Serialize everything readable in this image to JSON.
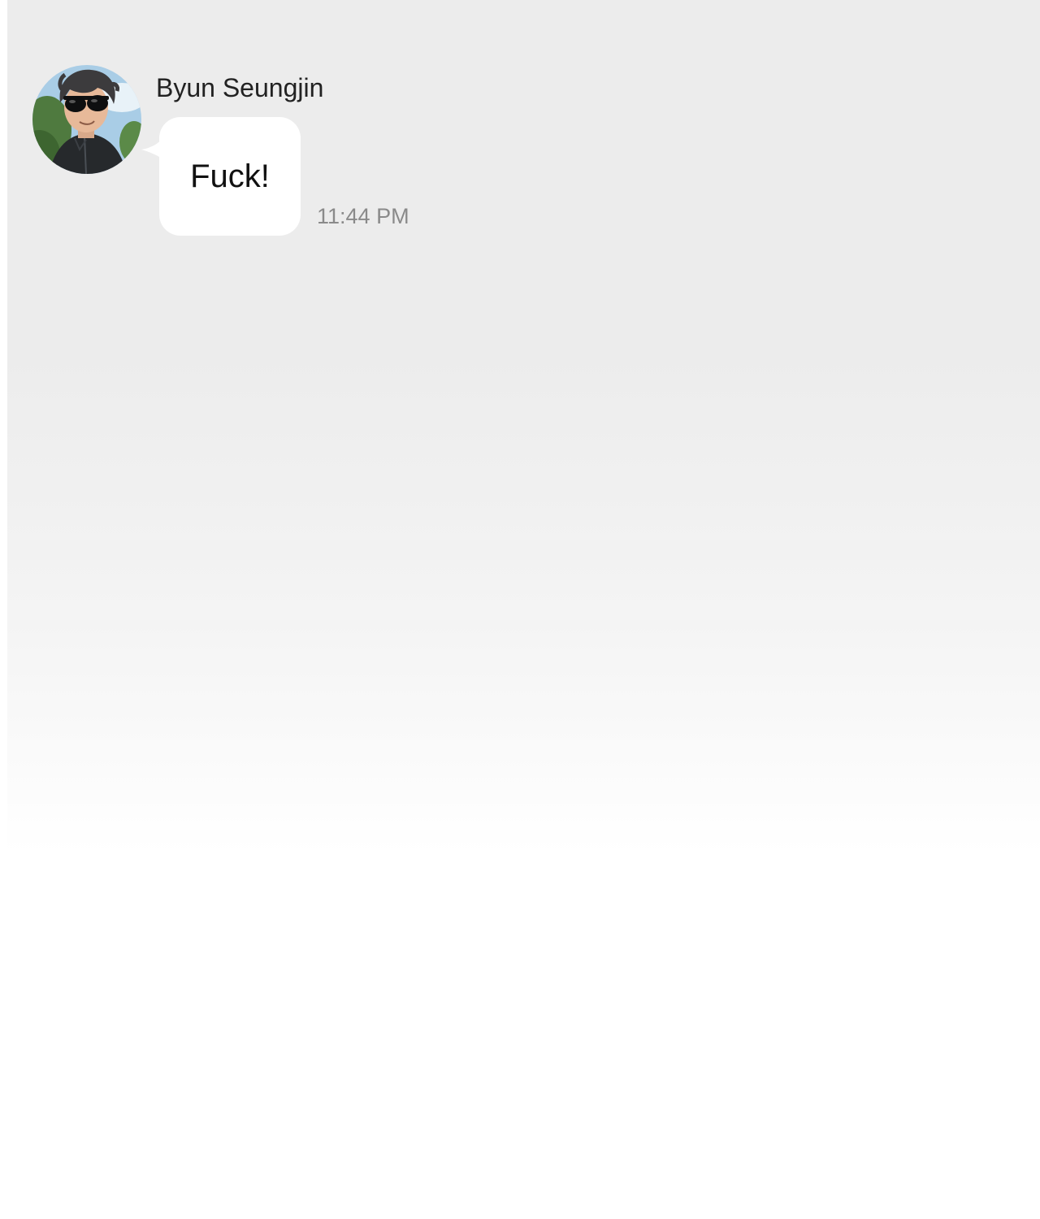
{
  "chat": {
    "messages": [
      {
        "sender": "Byun Seungjin",
        "text": "Fuck!",
        "time": "11:44 PM"
      }
    ]
  },
  "colors": {
    "background_top": "#ececec",
    "background_bottom": "#ffffff",
    "bubble": "#ffffff",
    "name_text": "#222222",
    "message_text": "#111111",
    "timestamp_text": "#8a8a8a",
    "speed_lines": "#d9d9d9"
  }
}
